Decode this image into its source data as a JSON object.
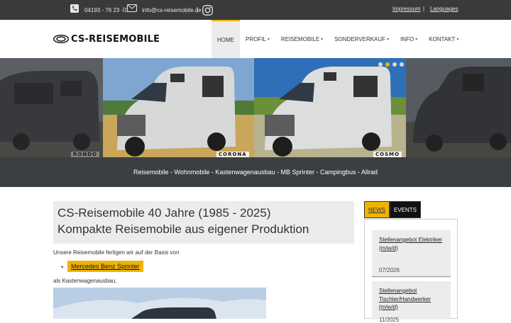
{
  "topbar": {
    "phone": "04193 - 76 23 - 0",
    "email": "info@cs-reisemobile.de",
    "separator": "|",
    "impressum": "Impressum",
    "languages": "Languages"
  },
  "header": {
    "logo_text": "CS-REISEMOBILE",
    "nav": [
      {
        "label": "HOME",
        "active": true
      },
      {
        "label": "PROFIL",
        "caret": "▾"
      },
      {
        "label": "REISEMOBILE",
        "caret": "▾"
      },
      {
        "label": "SONDERVERKAUF",
        "caret": "▾"
      },
      {
        "label": "INFO",
        "caret": "▾"
      },
      {
        "label": "KONTAKT",
        "caret": "▾"
      }
    ]
  },
  "slider": {
    "slides": [
      "RONDO",
      "CORONA",
      "COSMO"
    ],
    "dot_count": 4,
    "active_dot": 1
  },
  "tagline": "Reisemobile - Wohnmobile - Kastenwagenausbau - MB Sprinter - Campingbus - Allrad",
  "main": {
    "headline_1": "CS-Reisemobile 40 Jahre (1985 - 2025)",
    "headline_2": "Kompakte Reisemobile aus eigener Produktion",
    "intro": "Unsere Reisemobile fertigen wir auf der Basis von",
    "bullet_link": "Mercedes Benz Sprinter",
    "bullet_mark": "•",
    "outro": "als Kastenwagenausbau."
  },
  "sidebar": {
    "tab_news": "NEWS",
    "tab_events": "EVENTS",
    "items": [
      {
        "title": "Stellenangebot Elektriker (m/w/d)",
        "date": "07/2026"
      },
      {
        "title": "Stellenangebot Tischler/Handwerker (m/w/d)",
        "date": "11/2025"
      }
    ]
  },
  "colors": {
    "accent": "#f0b400",
    "topbar": "#3a3a3a",
    "tagline_band": "#3c3f42"
  }
}
